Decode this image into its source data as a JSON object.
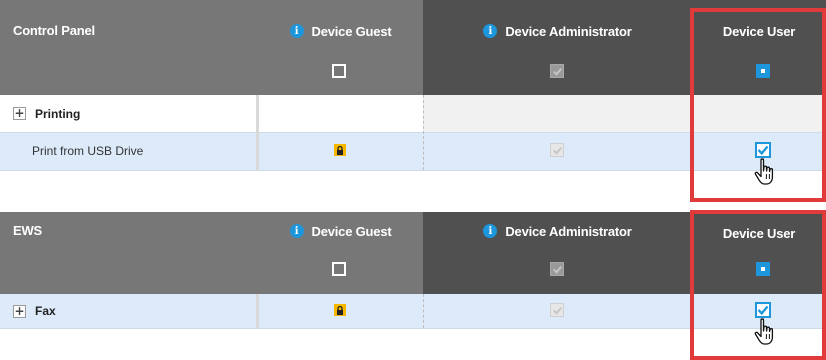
{
  "sections": [
    {
      "title": "Control Panel",
      "col_guest": "Device Guest",
      "col_admin": "Device Administrator",
      "col_user": "Device User",
      "rows": [
        {
          "label": "Printing"
        },
        {
          "label": "Print from USB Drive"
        }
      ]
    },
    {
      "title": "EWS",
      "col_guest": "Device Guest",
      "col_admin": "Device Administrator",
      "col_user": "Device User",
      "rows": [
        {
          "label": "Fax"
        }
      ]
    }
  ],
  "icons": {
    "info": "i",
    "expand": "+",
    "lock": "lock-icon",
    "cursor": "hand-pointer-icon"
  },
  "colors": {
    "header_grey": "#777777",
    "header_dark": "#505050",
    "accent_blue": "#1e96dc",
    "row_highlight": "#ddeafa",
    "lock_yellow": "#f5b800",
    "highlight_red": "#e03a3a"
  }
}
